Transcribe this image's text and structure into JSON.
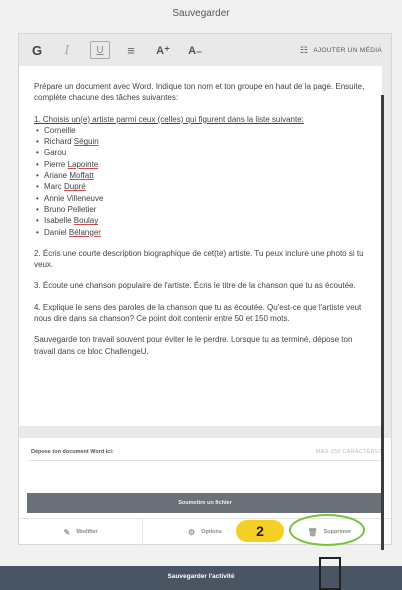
{
  "header": {
    "title": "Sauvegarder"
  },
  "toolbar": {
    "bold": "G",
    "italic": "I",
    "underline": "U",
    "list_icon": "≡",
    "superscript": "A⁺",
    "subscript": "A₋",
    "media_icon": "grid-icon",
    "add_media": "AJOUTER UN MÉDIA"
  },
  "content": {
    "intro": "Prépare un document avec Word. Indique ton nom et ton groupe en haut de la page. Ensuite, complète chacune des tâches suivantes:",
    "task1_heading": "1. Choisis un(e) artiste parmi ceux (celles) qui figurent dans la liste suivante:",
    "artists": [
      "Corneille",
      "Richard Séguin",
      "Garou",
      "Pierre Lapointe",
      "Ariane Moffatt",
      "Marc Dupré",
      "Annie Villeneuve",
      "Bruno Pelletier",
      "Isabelle Boulay",
      "Daniel Bélanger"
    ],
    "task2": "2. Écris une courte description biographique de cet(te) artiste. Tu peux inclure une photo si tu veux.",
    "task3": "3. Écoute une chanson populaire de l'artiste. Écris le titre de la chanson que tu as écoutée.",
    "task4": "4. Explique le sens des paroles de la chanson que tu as écoutée. Qu'est-ce que l'artiste veut nous dire dans sa chanson? Ce point doit contenir entre 50 et 150 mots.",
    "closing": "Sauvegarde ton travail souvent pour éviter le le perdre. Lorsque tu as terminé, dépose ton travail dans ce bloc ChallengeU."
  },
  "upload": {
    "label": "Dépose ton document Word ici:",
    "max": "MAX 250 CARACTÈRES",
    "submit": "Soumettre un fichier"
  },
  "actions": {
    "modify": "Modifier",
    "modify_icon": "pencil-icon",
    "options": "Options",
    "options_icon": "gear-icon",
    "delete": "Supprimer",
    "delete_icon": "trash-icon"
  },
  "annotation": {
    "step_number": "2"
  },
  "footer": {
    "save_activity": "Sauvegarder l'activité"
  },
  "colors": {
    "badge": "#f6cf24",
    "ring": "#78c237",
    "footer": "#4a5564",
    "button": "#6a7178"
  }
}
